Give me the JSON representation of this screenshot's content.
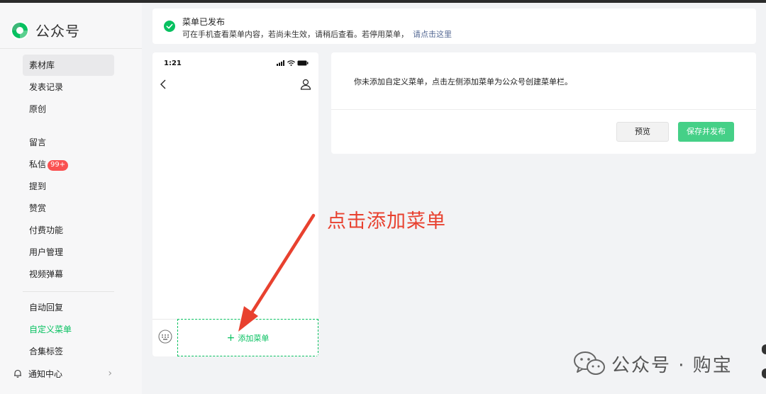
{
  "brand": {
    "name": "公众号",
    "accent": "#07c160"
  },
  "sidebar": {
    "items": [
      {
        "label": "素材库"
      },
      {
        "label": "发表记录"
      },
      {
        "label": "原创"
      },
      {
        "label": "留言"
      },
      {
        "label": "私信",
        "badge": "99+"
      },
      {
        "label": "提到"
      },
      {
        "label": "赞赏"
      },
      {
        "label": "付费功能"
      },
      {
        "label": "用户管理"
      },
      {
        "label": "视频弹幕"
      },
      {
        "label": "自动回复"
      },
      {
        "label": "自定义菜单"
      },
      {
        "label": "合集标签"
      }
    ],
    "notice_center": "通知中心"
  },
  "toast": {
    "title": "菜单已发布",
    "desc": "可在手机查看菜单内容，若尚未生效，请稍后查看。若停用菜单，",
    "link": "请点击这里"
  },
  "phone": {
    "time": "1:21",
    "add_menu": "添加菜单"
  },
  "panel": {
    "message": "你未添加自定义菜单，点击左侧添加菜单为公众号创建菜单栏。",
    "preview_button": "预览",
    "publish_button": "保存并发布"
  },
  "annotation": {
    "text": "点击添加菜单",
    "color": "#e8412f"
  },
  "watermark": {
    "text": "公众号 · 购宝"
  }
}
